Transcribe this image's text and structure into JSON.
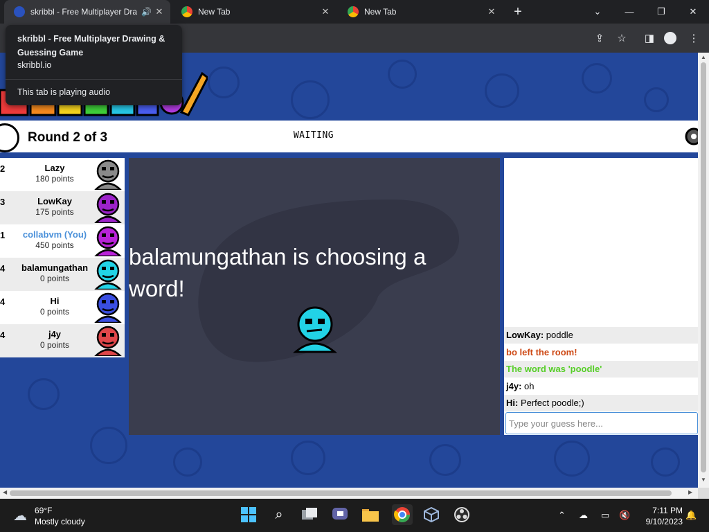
{
  "browser": {
    "tabs": [
      {
        "title": "skribbl - Free Multiplayer Dra",
        "active": true
      },
      {
        "title": "New Tab",
        "active": false
      },
      {
        "title": "New Tab",
        "active": false
      }
    ],
    "new_tab_icon": "plus-icon",
    "tooltip": {
      "title": "skribbl - Free Multiplayer Drawing & Guessing Game",
      "url": "skribbl.io",
      "audio_note": "This tab is playing audio"
    }
  },
  "game": {
    "round_text": "Round 2 of 3",
    "status": "WAITING",
    "choosing_text": "balamungathan is choosing a word!",
    "players": [
      {
        "rank": "2",
        "name": "Lazy",
        "points": "180 points",
        "color": "#8a8a8a",
        "is_you": false
      },
      {
        "rank": "3",
        "name": "LowKay",
        "points": "175 points",
        "color": "#9c23c9",
        "is_you": false
      },
      {
        "rank": "1",
        "name": "collabvm (You)",
        "points": "450 points",
        "color": "#b923d9",
        "is_you": true
      },
      {
        "rank": "4",
        "name": "balamungathan",
        "points": "0 points",
        "color": "#22d3e6",
        "is_you": false
      },
      {
        "rank": "4",
        "name": "Hi",
        "points": "0 points",
        "color": "#3a4ee0",
        "is_you": false
      },
      {
        "rank": "4",
        "name": "j4y",
        "points": "0 points",
        "color": "#e0474a",
        "is_you": false
      }
    ],
    "chat": [
      {
        "author": "LowKay:",
        "text": " poddle",
        "color": "#000000"
      },
      {
        "author": "",
        "text": "bo left the room!",
        "color": "#ce4a16"
      },
      {
        "author": "",
        "text": "The word was 'poodle'",
        "color": "#56ce27"
      },
      {
        "author": "j4y:",
        "text": " oh",
        "color": "#000000"
      },
      {
        "author": "Hi:",
        "text": " Perfect poodle;)",
        "color": "#000000"
      }
    ],
    "guess_placeholder": "Type your guess here..."
  },
  "taskbar": {
    "weather_temp": "69°F",
    "weather_desc": "Mostly cloudy",
    "time": "7:11 PM",
    "date": "9/10/2023"
  }
}
